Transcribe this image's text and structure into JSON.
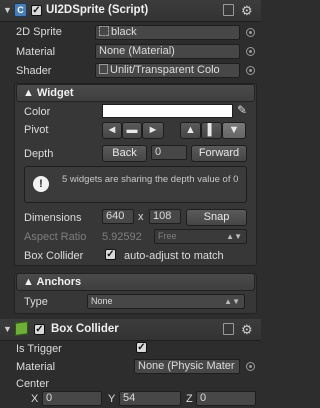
{
  "sprite_component": {
    "title": "UI2DSprite (Script)",
    "fields": [
      {
        "label": "2D Sprite",
        "value": "black"
      },
      {
        "label": "Material",
        "value": "None (Material)"
      },
      {
        "label": "Shader",
        "value": "Unlit/Transparent Colo"
      }
    ]
  },
  "widget": {
    "title": "Widget",
    "color_label": "Color",
    "pivot_label": "Pivot",
    "pivot_buttons": [
      "◄",
      "▬",
      "►",
      "▲",
      "▌",
      "▼"
    ],
    "depth_label": "Depth",
    "depth_back": "Back",
    "depth_value": "0",
    "depth_forward": "Forward",
    "info_text": "5 widgets are sharing the depth value of 0",
    "dimensions_label": "Dimensions",
    "width": "640",
    "x_sep": "x",
    "height": "108",
    "snap_label": "Snap",
    "aspect_label": "Aspect Ratio",
    "aspect_value": "5.92592",
    "aspect_mode": "Free",
    "box_collider_label": "Box Collider",
    "auto_adjust_label": "auto-adjust to match",
    "color": "#ffffff"
  },
  "anchors": {
    "title": "Anchors",
    "type_label": "Type",
    "type_value": "None"
  },
  "box_collider": {
    "title": "Box Collider",
    "is_trigger_label": "Is Trigger",
    "material_label": "Material",
    "material_value": "None (Physic Mater",
    "center_label": "Center",
    "x_label": "X",
    "x_value": "0",
    "y_label": "Y",
    "y_value": "54",
    "z_label": "Z",
    "z_value": "0"
  }
}
